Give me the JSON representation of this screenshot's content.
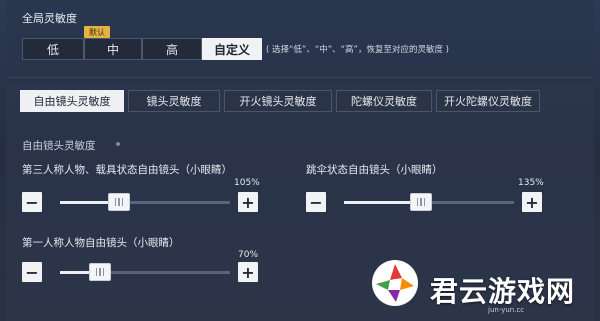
{
  "global": {
    "title": "全局灵敏度",
    "default_badge": "默认",
    "options": [
      "低",
      "中",
      "高",
      "自定义"
    ],
    "selected": "自定义",
    "hint": "( 选择“低”、“中”、“高”，恢复至对应的灵敏度 )"
  },
  "tabs": [
    "自由镜头灵敏度",
    "镜头灵敏度",
    "开火镜头灵敏度",
    "陀螺仪灵敏度",
    "开火陀螺仪灵敏度"
  ],
  "active_tab": "自由镜头灵敏度",
  "section": {
    "title": "自由镜头灵敏度"
  },
  "sliders": [
    {
      "label": "第三人称人物、载具状态自由镜头（小眼睛）",
      "percent_text": "105%",
      "value": 105,
      "max": 300
    },
    {
      "label": "跳伞状态自由镜头（小眼睛）",
      "percent_text": "135%",
      "value": 135,
      "max": 300
    },
    {
      "label": "第一人称人物自由镜头（小眼睛）",
      "percent_text": "70%",
      "value": 70,
      "max": 300
    }
  ],
  "controls": {
    "minus": "−",
    "plus": "+"
  },
  "watermark": {
    "name": "君云游戏网",
    "sub": "jun-yun.cc"
  },
  "colors": {
    "accent_badge": "#e3b347",
    "active_bg": "#eef0f3",
    "panel": "#2a3346"
  }
}
